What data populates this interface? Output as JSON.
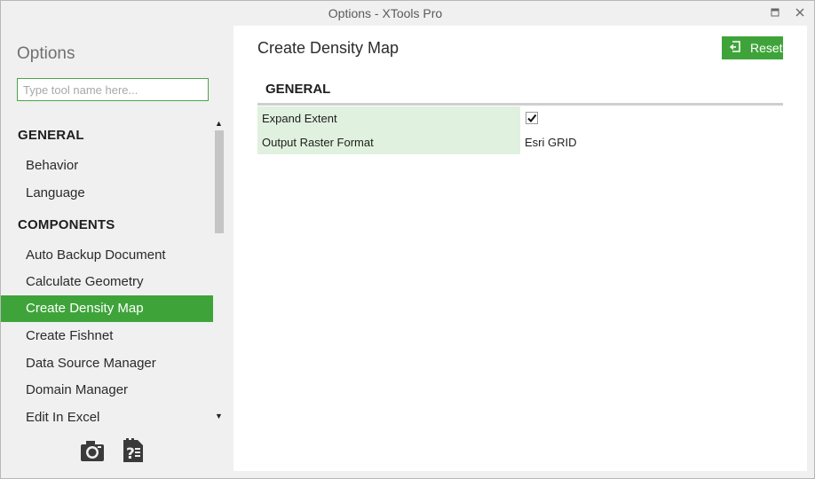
{
  "window": {
    "title": "Options - XTools Pro",
    "restore_icon": "restore-icon",
    "close_icon": "close-icon"
  },
  "sidebar": {
    "title": "Options",
    "search_placeholder": "Type tool name here...",
    "sections": [
      {
        "header": "GENERAL",
        "items": [
          "Behavior",
          "Language"
        ]
      },
      {
        "header": "COMPONENTS",
        "items": [
          "Auto Backup Document",
          "Calculate Geometry",
          "Create Density Map",
          "Create Fishnet",
          "Data Source Manager",
          "Domain Manager",
          "Edit In Excel"
        ]
      }
    ],
    "active_item": "Create Density Map",
    "bottom_icons": [
      "camera-icon",
      "help-document-icon"
    ]
  },
  "main": {
    "title": "Create Density Map",
    "reset_label": "Reset",
    "reset_icon": "reset-icon",
    "section_title": "GENERAL",
    "properties": [
      {
        "name": "Expand Extent",
        "value": "",
        "checked": true
      },
      {
        "name": "Output Raster Format",
        "value": "Esri GRID"
      }
    ]
  },
  "colors": {
    "accent": "#3ea43a",
    "property_name_bg": "#e0f1df",
    "sidebar_bg": "#f0f0f0"
  }
}
